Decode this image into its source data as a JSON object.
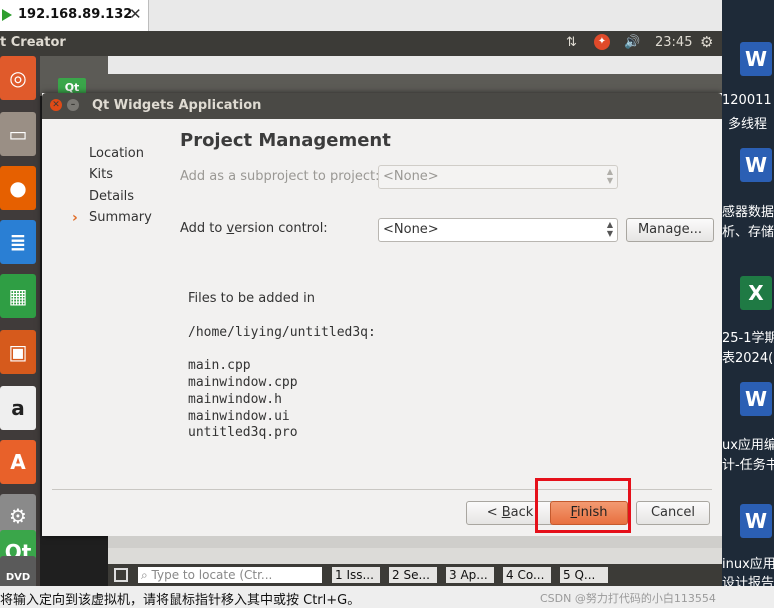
{
  "host": {
    "tab_title": "192.168.89.132",
    "close_glyph": "✕",
    "status_message": "将输入定向到该虚拟机，请将鼠标指针移入其中或按 Ctrl+G。",
    "watermark": "CSDN @努力打代码的小白113554"
  },
  "top_panel": {
    "app_title": "t Creator",
    "clock": "23:45",
    "icons": [
      "network-icon",
      "update-icon",
      "volume-icon",
      "settings-gear-icon"
    ]
  },
  "launcher": {
    "items": [
      {
        "name": "ubuntu-dash-icon",
        "glyph": "◎",
        "color": "#e05a2b"
      },
      {
        "name": "files-icon",
        "glyph": "▭",
        "color": "#9a8f85"
      },
      {
        "name": "firefox-icon",
        "glyph": "●",
        "color": "#e66000"
      },
      {
        "name": "writer-icon",
        "glyph": "≣",
        "color": "#2a7fd4"
      },
      {
        "name": "calc-icon",
        "glyph": "▦",
        "color": "#2f9e44"
      },
      {
        "name": "impress-icon",
        "glyph": "▣",
        "color": "#d65a1c"
      },
      {
        "name": "amazon-icon",
        "glyph": "a",
        "color": "#efefef"
      },
      {
        "name": "software-center-icon",
        "glyph": "A",
        "color": "#e8612a"
      },
      {
        "name": "system-settings-icon",
        "glyph": "⚙",
        "color": "#8a8a8a"
      },
      {
        "name": "qt-creator-icon",
        "glyph": "Qt",
        "color": "#3aa64a"
      },
      {
        "name": "dvd-icon",
        "glyph": "DVD",
        "color": "#5a5a5a"
      }
    ]
  },
  "ide": {
    "tab_icon_label": "Qt",
    "locate_placeholder": "Type to locate (Ctr...",
    "panes": [
      "1 Iss...",
      "2 Se...",
      "3 Ap...",
      "4 Co...",
      "5 Q..."
    ]
  },
  "dialog": {
    "title": "Qt Widgets Application",
    "page_title": "Project Management",
    "sidebar": [
      {
        "label": "Location",
        "current": false
      },
      {
        "label": "Kits",
        "current": false
      },
      {
        "label": "Details",
        "current": false
      },
      {
        "label": "Summary",
        "current": true
      }
    ],
    "subproject_label": "Add as a subproject to project:",
    "subproject_value": "<None>",
    "vcs_label": "Add to version control:",
    "vcs_value": "<None>",
    "manage_label": "Manage...",
    "files_header": "Files to be added in",
    "files_path": "/home/liying/untitled3q:",
    "files": [
      "main.cpp",
      "mainwindow.cpp",
      "mainwindow.h",
      "mainwindow.ui",
      "untitled3q.pro"
    ],
    "back_label": "< Back",
    "finish_label": "Finish",
    "cancel_label": "Cancel"
  },
  "desktop": {
    "icons": [
      {
        "name": "word-doc-icon",
        "letter": "W",
        "color": "#2b5fb4"
      },
      {
        "name": "word-doc-icon",
        "letter": "W",
        "color": "#2b5fb4"
      },
      {
        "name": "excel-doc-icon",
        "letter": "X",
        "color": "#1f7a44"
      },
      {
        "name": "word-doc-icon",
        "letter": "W",
        "color": "#2b5fb4"
      },
      {
        "name": "word-doc-icon",
        "letter": "W",
        "color": "#2b5fb4"
      }
    ],
    "labels": [
      "120011",
      "多线程",
      "感器数据",
      "析、存储",
      "25-1学期",
      "表2024(",
      "ux应用编",
      "计-任务书",
      "inux应用",
      "设计报告"
    ]
  }
}
